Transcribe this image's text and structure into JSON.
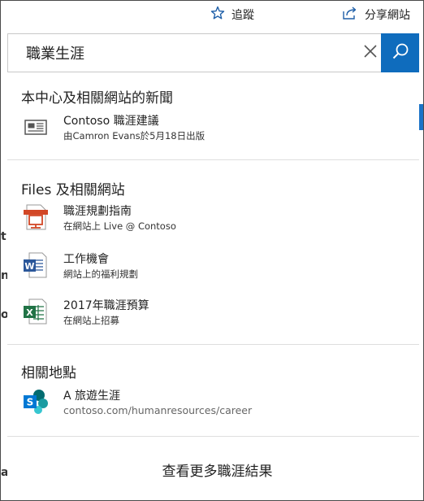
{
  "header": {
    "follow_label": "追蹤",
    "share_label": "分享網站"
  },
  "search": {
    "value": "職業生涯"
  },
  "sections": {
    "news": {
      "title": "本中心及相關網站的新聞",
      "items": [
        {
          "title": "Contoso 職涯建議",
          "subtitle": "由Camron Evans於5月18日出版",
          "icon": "news-icon"
        }
      ]
    },
    "files": {
      "title": "Files 及相關網站",
      "items": [
        {
          "title": "職涯規劃指南",
          "subtitle": "在網站上 Live @ Contoso",
          "icon": "presentation-file-icon"
        },
        {
          "title": "工作機會",
          "subtitle": "網站上的福利規劃",
          "icon": "word-file-icon"
        },
        {
          "title": "2017年職涯預算",
          "subtitle": "在網站上招募",
          "icon": "excel-file-icon"
        }
      ]
    },
    "sites": {
      "title": "相關地點",
      "items": [
        {
          "title": "A 旅遊生涯",
          "subtitle": "contoso.com/humanresources/career",
          "icon": "sharepoint-site-icon"
        }
      ]
    }
  },
  "more_results_label": "查看更多職涯結果",
  "background": {
    "letters": [
      "t",
      "n",
      "o",
      "a"
    ]
  },
  "colors": {
    "accent": "#0f6cbd",
    "word": "#2b579a",
    "excel": "#217346",
    "powerpoint": "#d24726",
    "sharepoint": "#0078d4"
  }
}
